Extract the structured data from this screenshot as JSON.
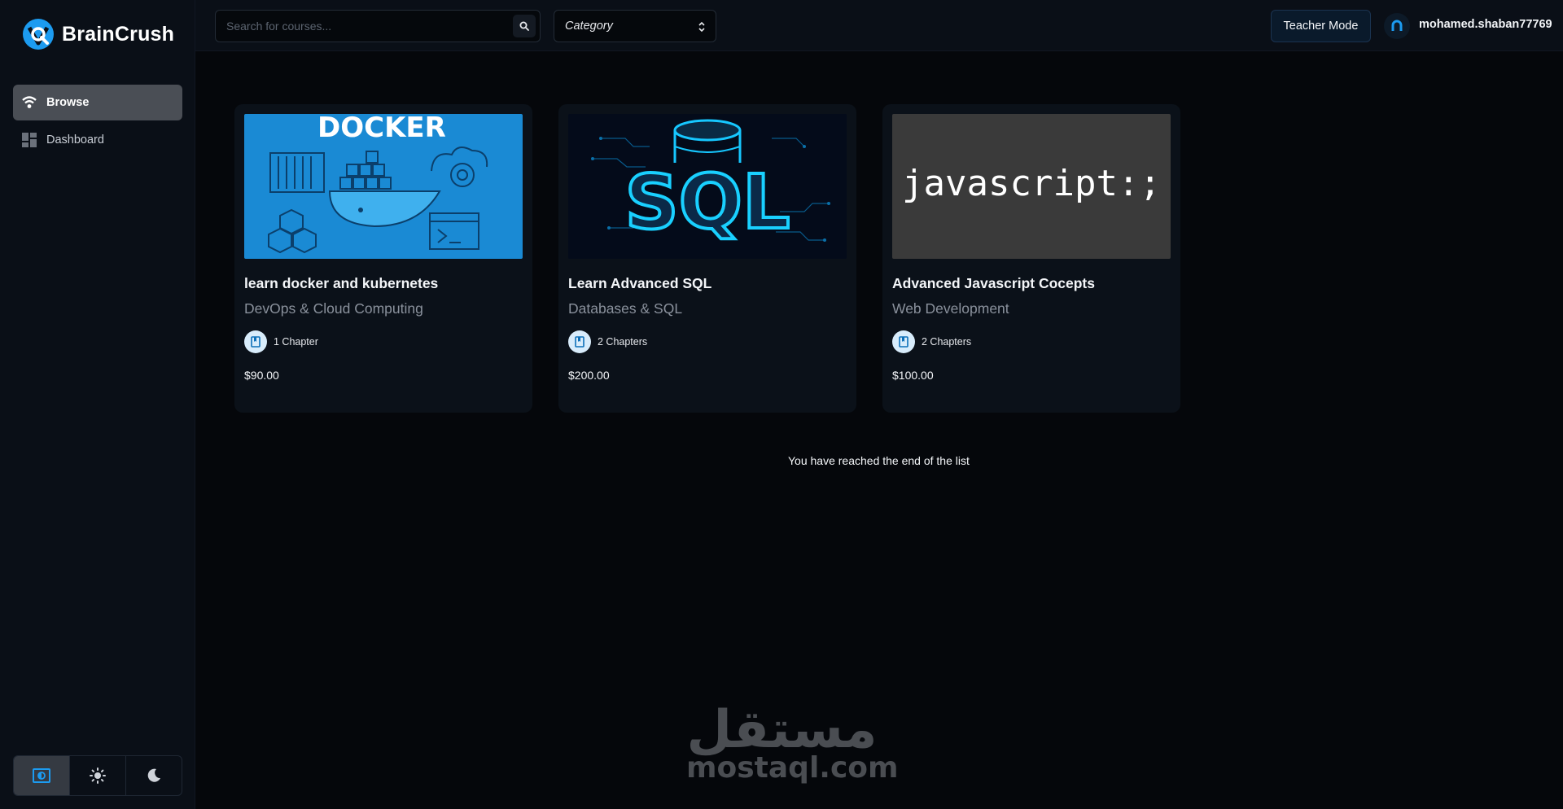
{
  "app": {
    "name": "BrainCrush",
    "brand_color": "#1c9bf0"
  },
  "sidebar": {
    "items": [
      {
        "label": "Browse",
        "icon": "compass-icon",
        "active": true
      },
      {
        "label": "Dashboard",
        "icon": "dashboard-icon",
        "active": false
      }
    ],
    "theme_modes": [
      {
        "name": "system",
        "icon": "system-theme-icon",
        "active": true
      },
      {
        "name": "light",
        "icon": "sun-icon",
        "active": false
      },
      {
        "name": "dark",
        "icon": "moon-icon",
        "active": false
      }
    ]
  },
  "header": {
    "search_placeholder": "Search for courses...",
    "category_label": "Category",
    "teacher_mode_label": "Teacher Mode",
    "username": "mohamed.shaban77769"
  },
  "courses": [
    {
      "title": "learn docker and kubernetes",
      "category": "DevOps & Cloud Computing",
      "chapters": "1 Chapter",
      "price": "$90.00",
      "thumb_text": "DOCKER"
    },
    {
      "title": "Learn Advanced SQL",
      "category": "Databases & SQL",
      "chapters": "2 Chapters",
      "price": "$200.00",
      "thumb_text": "SQL"
    },
    {
      "title": "Advanced Javascript Cocepts",
      "category": "Web Development",
      "chapters": "2 Chapters",
      "price": "$100.00",
      "thumb_text": "javascript:;"
    }
  ],
  "end_message": "You have reached the end of the list",
  "watermark": {
    "arabic": "مستقل",
    "latin": "mostaql.com"
  }
}
